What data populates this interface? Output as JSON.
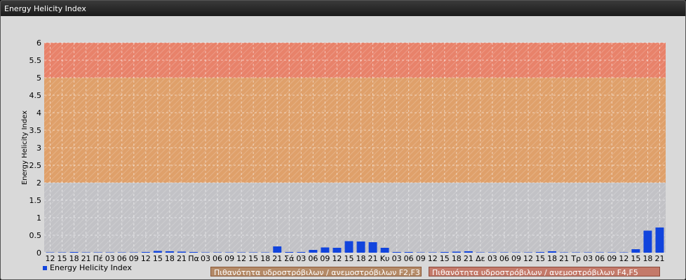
{
  "window": {
    "title": "Energy Helicity Index"
  },
  "legend": {
    "series_label": "Energy Helicity Index",
    "zones": [
      {
        "label": "Πιθανότητα υδροστρόβιλων / ανεμοστρόβιλων F2,F3",
        "color": "#b48a67",
        "border": "#8a5a3a"
      },
      {
        "label": "Πιθανότητα υδροστρόβιλων / ανεμοστρόβιλων F4,F5",
        "color": "#c47a6a",
        "border": "#8a4a3a"
      }
    ]
  },
  "chart_data": {
    "type": "bar",
    "ylabel": "Energy Helicity Index",
    "xlabel": "",
    "ylim": [
      0,
      6
    ],
    "yticks": [
      "0",
      "0.5",
      "1",
      "1.5",
      "2",
      "2.5",
      "3",
      "3.5",
      "4",
      "4.5",
      "5",
      "5.5",
      "6"
    ],
    "bands": [
      {
        "from": 0,
        "to": 2,
        "color": "#c2c2c6"
      },
      {
        "from": 2,
        "to": 5,
        "color": "#dfa06a"
      },
      {
        "from": 5,
        "to": 6,
        "color": "#e8826a"
      }
    ],
    "bar_color": "#1144dd",
    "categories": [
      "12",
      "15",
      "18",
      "21",
      "Πέ",
      "03",
      "06",
      "09",
      "12",
      "15",
      "18",
      "21",
      "Πα",
      "03",
      "06",
      "09",
      "12",
      "15",
      "18",
      "21",
      "Σά",
      "03",
      "06",
      "09",
      "12",
      "15",
      "18",
      "21",
      "Κυ",
      "03",
      "06",
      "09",
      "12",
      "15",
      "18",
      "21",
      "Δε",
      "03",
      "06",
      "09",
      "12",
      "15",
      "18",
      "21",
      "Τρ",
      "03",
      "06",
      "09",
      "12",
      "15",
      "18",
      "21"
    ],
    "series": [
      {
        "values": [
          0.01,
          0.01,
          0.02,
          0.01,
          0.01,
          0.01,
          0.01,
          0.01,
          0.02,
          0.05,
          0.04,
          0.03,
          0.02,
          0.01,
          0.01,
          0.01,
          0.01,
          0.01,
          0.01,
          0.18,
          0.02,
          0.02,
          0.08,
          0.15,
          0.14,
          0.33,
          0.32,
          0.3,
          0.14,
          0.02,
          0.02,
          0.01,
          0.01,
          0.02,
          0.03,
          0.04,
          0.01,
          0.01,
          0.01,
          0.01,
          0.01,
          0.02,
          0.04,
          0.01,
          0.01,
          0.01,
          0.01,
          0.01,
          0.01,
          0.1,
          0.63,
          0.72
        ]
      }
    ],
    "grid": true
  }
}
